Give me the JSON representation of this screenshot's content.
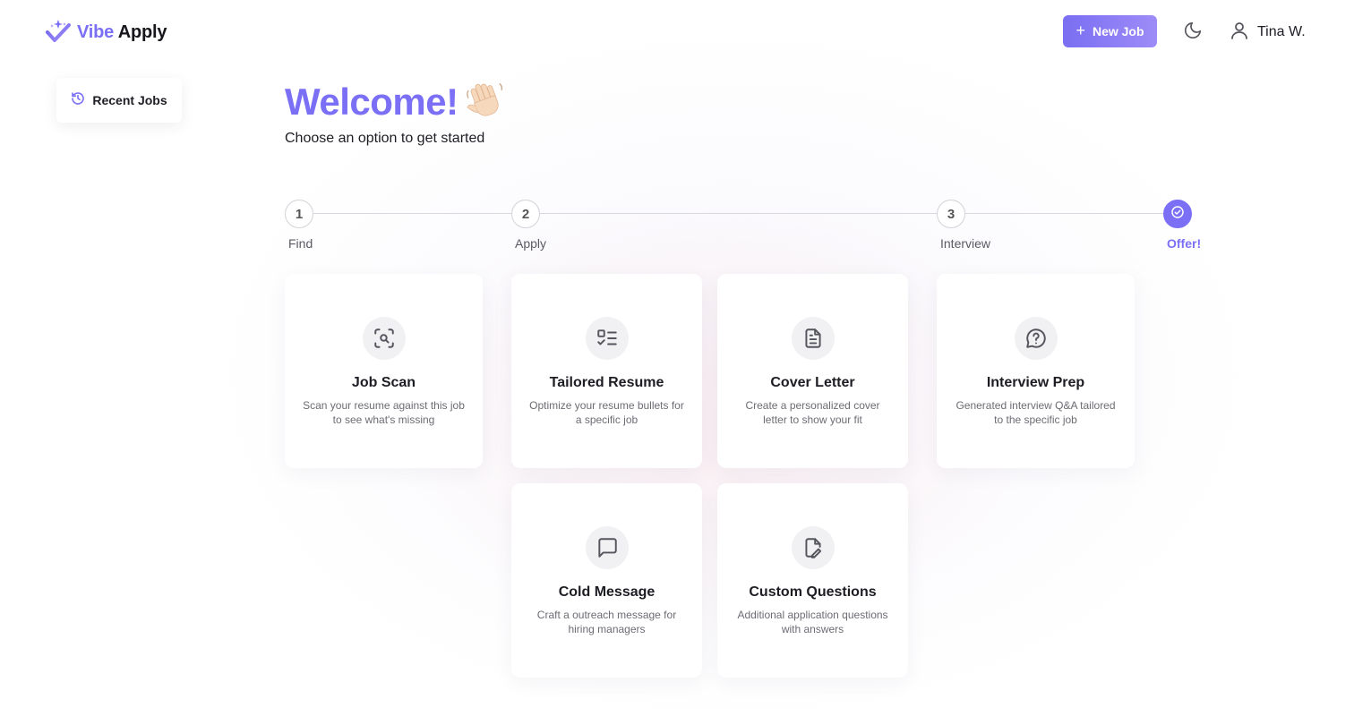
{
  "header": {
    "brand_part1": "Vibe",
    "brand_part2": "Apply",
    "new_job_label": "New Job",
    "user_name": "Tina W."
  },
  "sidebar": {
    "recent_jobs_label": "Recent Jobs"
  },
  "welcome": {
    "title": "Welcome!",
    "emoji": "👋",
    "subtitle": "Choose an option to get started"
  },
  "steps": [
    {
      "number": "1",
      "label": "Find",
      "state": "pending"
    },
    {
      "number": "2",
      "label": "Apply",
      "state": "pending"
    },
    {
      "number": "3",
      "label": "Interview",
      "state": "pending"
    },
    {
      "number": "",
      "label": "Offer!",
      "state": "complete"
    }
  ],
  "cards": [
    {
      "title": "Job Scan",
      "description": "Scan your resume against this job to see what's missing",
      "icon": "scan-search-icon"
    },
    {
      "title": "Tailored Resume",
      "description": "Optimize your resume bullets for a specific job",
      "icon": "checklist-icon"
    },
    {
      "title": "Cover Letter",
      "description": "Create a personalized cover letter to show your fit",
      "icon": "document-icon"
    },
    {
      "title": "Interview Prep",
      "description": "Generated interview Q&A tailored to the specific job",
      "icon": "question-bubble-icon"
    },
    {
      "title": "Cold Message",
      "description": "Craft a outreach message for hiring managers",
      "icon": "message-icon"
    },
    {
      "title": "Custom Questions",
      "description": "Additional application questions with answers",
      "icon": "file-pen-icon"
    }
  ],
  "colors": {
    "accent": "#7a6ff5",
    "button_gradient_start": "#7a6ef2",
    "button_gradient_end": "#9d8cf7",
    "icon_stroke": "#55555e",
    "icon_bg": "#f1f1f3"
  }
}
